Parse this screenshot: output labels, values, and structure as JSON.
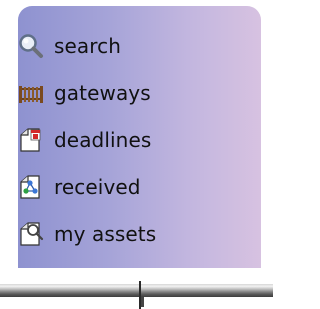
{
  "nav": {
    "items": [
      {
        "label": "search",
        "icon": "magnifier-search-icon"
      },
      {
        "label": "gateways",
        "icon": "fence-gate-icon"
      },
      {
        "label": "deadlines",
        "icon": "calendar-document-icon"
      },
      {
        "label": "received",
        "icon": "document-with-network-icon"
      },
      {
        "label": "my assets",
        "icon": "document-magnifier-icon"
      }
    ]
  },
  "colors": {
    "panel_left": "#8e92d0",
    "panel_right": "#d7c2e1",
    "text": "#111111"
  }
}
